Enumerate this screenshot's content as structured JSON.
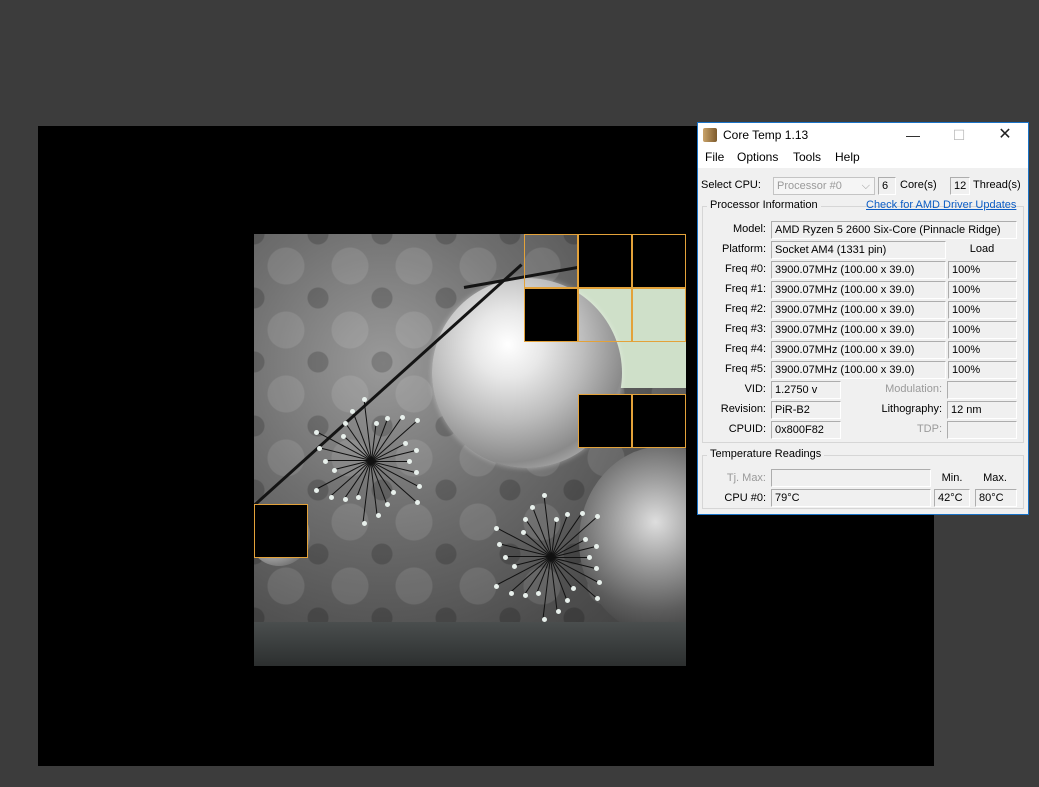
{
  "window": {
    "title": "Core Temp 1.13",
    "controls": {
      "minimize": "—",
      "maximize": "☐",
      "close": "✕"
    }
  },
  "menu": [
    "File",
    "Options",
    "Tools",
    "Help"
  ],
  "select_cpu": {
    "label": "Select CPU:",
    "value": "Processor #0",
    "cores_value": "6",
    "cores_label": "Core(s)",
    "threads_value": "12",
    "threads_label": "Thread(s)"
  },
  "processor_info": {
    "group_title": "Processor Information",
    "link": "Check for AMD Driver Updates",
    "model_label": "Model:",
    "model": "AMD Ryzen 5 2600 Six-Core (Pinnacle Ridge)",
    "platform_label": "Platform:",
    "platform": "Socket AM4 (1331 pin)",
    "load_header": "Load",
    "freqs": [
      {
        "label": "Freq #0:",
        "value": "3900.07MHz (100.00 x 39.0)",
        "load": "100%"
      },
      {
        "label": "Freq #1:",
        "value": "3900.07MHz (100.00 x 39.0)",
        "load": "100%"
      },
      {
        "label": "Freq #2:",
        "value": "3900.07MHz (100.00 x 39.0)",
        "load": "100%"
      },
      {
        "label": "Freq #3:",
        "value": "3900.07MHz (100.00 x 39.0)",
        "load": "100%"
      },
      {
        "label": "Freq #4:",
        "value": "3900.07MHz (100.00 x 39.0)",
        "load": "100%"
      },
      {
        "label": "Freq #5:",
        "value": "3900.07MHz (100.00 x 39.0)",
        "load": "100%"
      }
    ],
    "vid_label": "VID:",
    "vid": "1.2750 v",
    "modulation_label": "Modulation:",
    "modulation": "",
    "revision_label": "Revision:",
    "revision": "PiR-B2",
    "lithography_label": "Lithography:",
    "lithography": "12 nm",
    "cpuid_label": "CPUID:",
    "cpuid": "0x800F82",
    "tdp_label": "TDP:",
    "tdp": ""
  },
  "temperature": {
    "group_title": "Temperature Readings",
    "tjmax_label": "Tj. Max:",
    "tjmax": "",
    "min_header": "Min.",
    "max_header": "Max.",
    "cpu0_label": "CPU #0:",
    "cpu0": "79°C",
    "cpu0_min": "42°C",
    "cpu0_max": "80°C"
  },
  "colors": {
    "tile_border": "#e3a23a",
    "window_border": "#1a73c7",
    "link": "#0b5cc4"
  }
}
